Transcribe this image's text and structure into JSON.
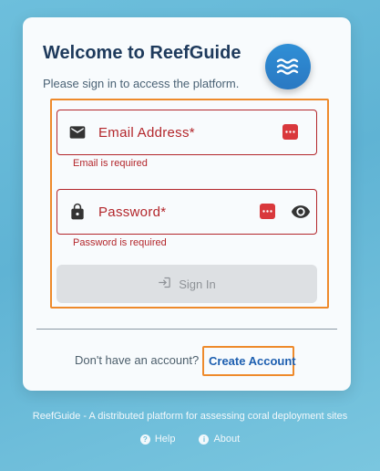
{
  "app": {
    "title": "Welcome to ReefGuide",
    "subtitle": "Please sign in to access the platform."
  },
  "form": {
    "email": {
      "label": "Email Address*",
      "error": "Email is required"
    },
    "password": {
      "label": "Password*",
      "error": "Password is required"
    },
    "signin_label": "Sign In"
  },
  "signup": {
    "prompt": "Don't have an account?",
    "link_label": "Create Account"
  },
  "footer": {
    "tagline": "ReefGuide - A distributed platform for assessing coral deployment sites",
    "help_label": "Help",
    "about_label": "About"
  },
  "icons": {
    "logo": "waves-icon",
    "email": "mail-icon",
    "password": "lock-icon",
    "password_manager": "password-manager-icon",
    "visibility": "eye-icon",
    "signin": "login-icon",
    "help": "help-icon",
    "about": "info-icon"
  },
  "colors": {
    "error": "#b3262b",
    "accent": "#1d5fb0",
    "highlight": "#ee8a2b",
    "logo": "#2f8fd6"
  }
}
